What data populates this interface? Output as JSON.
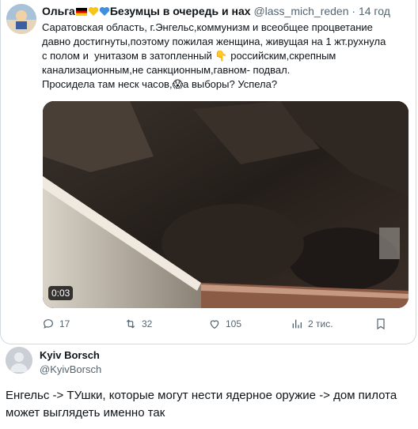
{
  "quote": {
    "author_name": "Ольга",
    "author_name_rest": "Безумцы в очередь и нах",
    "handle": "@lass_mich_reden",
    "separator": "·",
    "time": "14 год",
    "text_line1": "Саратовская область, г.Энгельс,коммунизм и всеобщее процветание",
    "text_line2": "давно достигнуты,поэтому пожилая женщина, живущая на 1 жт.рухнула",
    "text_line3a": "с полом и  унитазом в затопленный ",
    "text_line3b": " российским,скрепным",
    "text_line4": "канализационным,не санкционным,гавном- подвал.",
    "text_line5a": "Просидела там неск часов,",
    "text_line5b": "а выборы? Успела?",
    "video_duration": "0:03",
    "replies": "17",
    "retweets": "32",
    "likes": "105",
    "views": "2 тис.",
    "colors": {
      "text": "#0f1419",
      "muted": "#536471",
      "border": "#cfd9de"
    },
    "icons": [
      "flag-germany-icon",
      "yellow-heart-icon",
      "blue-heart-icon",
      "pointing-down-hand-icon",
      "screaming-face-icon",
      "reply-icon",
      "retweet-icon",
      "like-icon",
      "views-icon",
      "bookmark-icon"
    ]
  },
  "reply": {
    "name": "Kyiv Borsch",
    "handle": "@KyivBorsch",
    "text": "Енгельс -> ТУшки, которые могут нести ядерное оружие -> дом пилота может выглядеть именно так"
  }
}
